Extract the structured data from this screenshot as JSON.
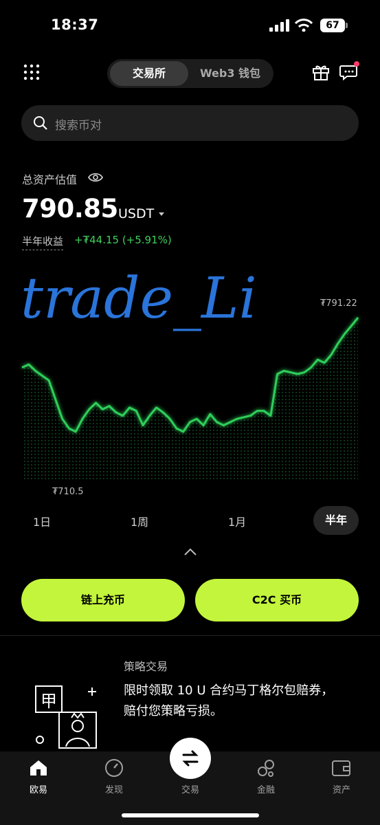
{
  "status_bar": {
    "time": "18:37",
    "battery": "67"
  },
  "header": {
    "tab_exchange": "交易所",
    "tab_wallet": "Web3 钱包"
  },
  "search": {
    "placeholder": "搜索币对"
  },
  "account": {
    "asset_label": "总资产估值",
    "balance": "790.85",
    "unit": "USDT",
    "period_label": "半年收益",
    "pnl": "+₮44.15 (+5.91%)",
    "watermark": "trade_Li"
  },
  "chart_data": {
    "type": "area",
    "max_label": "₮791.22",
    "min_label": "₮710.5",
    "ylim": [
      710.5,
      791.22
    ],
    "values": [
      760,
      762,
      758,
      755,
      752,
      740,
      728,
      722,
      720,
      728,
      734,
      738,
      734,
      736,
      732,
      730,
      735,
      733,
      724,
      730,
      735,
      732,
      728,
      722,
      720,
      726,
      728,
      724,
      731,
      726,
      724,
      726,
      728,
      729,
      730,
      733,
      733,
      730,
      756,
      758,
      757,
      756,
      757,
      760,
      765,
      763,
      768,
      775,
      781,
      786,
      791.22
    ]
  },
  "periods": [
    "1日",
    "1周",
    "1月",
    "半年"
  ],
  "buttons": {
    "deposit": "链上充币",
    "c2c": "C2C 买币"
  },
  "promo": {
    "tag": "策略交易",
    "text": "限时领取 10 U 合约马丁格尔包赔券，赔付您策略亏损。"
  },
  "nav": [
    "欧易",
    "发现",
    "交易",
    "金融",
    "资产"
  ],
  "colors": {
    "accent": "#c3f53c",
    "up": "#3fd05b",
    "line": "#2ecf5a"
  }
}
